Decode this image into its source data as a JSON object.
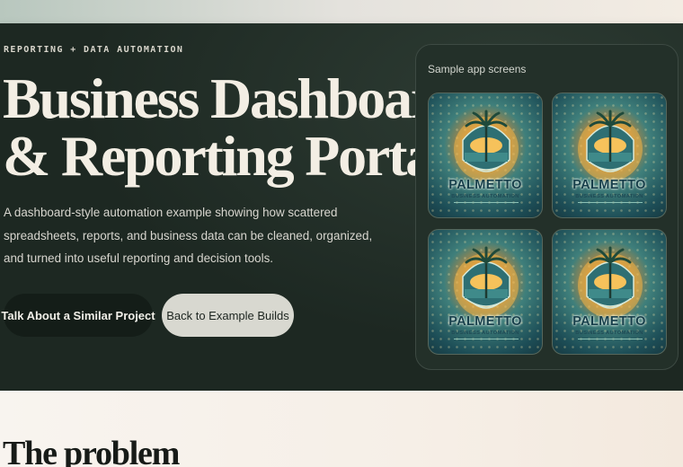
{
  "hero": {
    "eyebrow": "REPORTING + DATA AUTOMATION",
    "title_line_1": "Business Dashboard",
    "title_line_2": "& Reporting Portal",
    "lead": "A dashboard-style automation example showing how scattered spreadsheets, reports, and business data can be cleaned, organized, and turned into useful reporting and decision tools.",
    "primary_button": "Talk About a Similar Project",
    "secondary_button": "Back to Example Builds"
  },
  "gallery": {
    "label": "Sample app screens",
    "thumbnails": [
      {
        "brand": "PALMETTO",
        "tagline": "BUSINESS AUTOMATION"
      },
      {
        "brand": "PALMETTO",
        "tagline": "BUSINESS AUTOMATION"
      },
      {
        "brand": "PALMETTO",
        "tagline": "BUSINESS AUTOMATION"
      },
      {
        "brand": "PALMETTO",
        "tagline": "BUSINESS AUTOMATION"
      }
    ]
  },
  "next_section": {
    "title": "The problem"
  },
  "colors": {
    "hero_background": "#1d2822",
    "accent_gold": "#e08a2c",
    "accent_teal": "#1d4e57"
  }
}
